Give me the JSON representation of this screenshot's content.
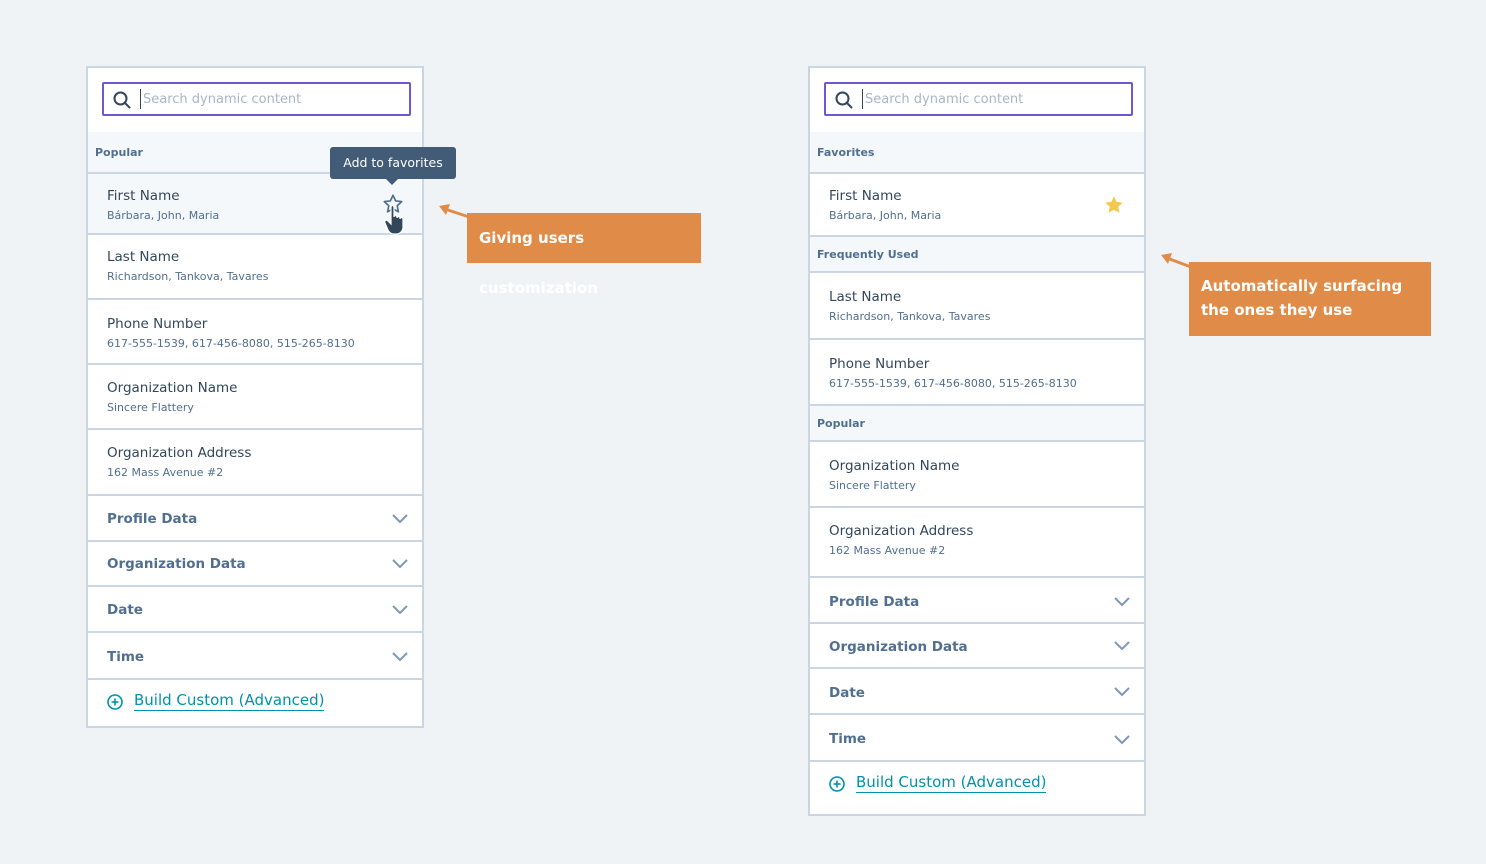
{
  "search": {
    "placeholder": "Search dynamic content"
  },
  "left_panel": {
    "popular_header": "Popular",
    "items": [
      {
        "title": "First Name",
        "sub": "Bárbara, John, Maria"
      },
      {
        "title": "Last Name",
        "sub": "Richardson, Tankova, Tavares"
      },
      {
        "title": "Phone Number",
        "sub": "617-555-1539, 617-456-8080, 515-265-8130"
      },
      {
        "title": "Organization Name",
        "sub": "Sincere Flattery"
      },
      {
        "title": "Organization Address",
        "sub": "162 Mass Avenue #2"
      }
    ],
    "groups": [
      "Profile Data",
      "Organization Data",
      "Date",
      "Time"
    ],
    "build_custom": "Build Custom (Advanced)",
    "tooltip": "Add to favorites"
  },
  "right_panel": {
    "favorites_header": "Favorites",
    "frequently_used_header": "Frequently Used",
    "popular_header": "Popular",
    "items": [
      {
        "title": "First Name",
        "sub": "Bárbara, John, Maria"
      },
      {
        "title": "Last Name",
        "sub": "Richardson, Tankova, Tavares"
      },
      {
        "title": "Phone Number",
        "sub": "617-555-1539, 617-456-8080, 515-265-8130"
      },
      {
        "title": "Organization Name",
        "sub": "Sincere Flattery"
      },
      {
        "title": "Organization Address",
        "sub": "162 Mass Avenue #2"
      }
    ],
    "groups": [
      "Profile Data",
      "Organization Data",
      "Date",
      "Time"
    ],
    "build_custom": "Build Custom (Advanced)"
  },
  "callouts": {
    "left": "Giving users customization",
    "right": "Automatically surfacing the ones they use"
  },
  "colors": {
    "callout": "#e08c48",
    "star": "#f2c94c",
    "accent": "#6a5acd",
    "link": "#0091ae"
  },
  "icons": [
    "search-icon",
    "star-outline-icon",
    "pointer-hand-icon",
    "star-filled-icon",
    "chevron-down-icon",
    "plus-circle-icon",
    "arrow-icon"
  ]
}
